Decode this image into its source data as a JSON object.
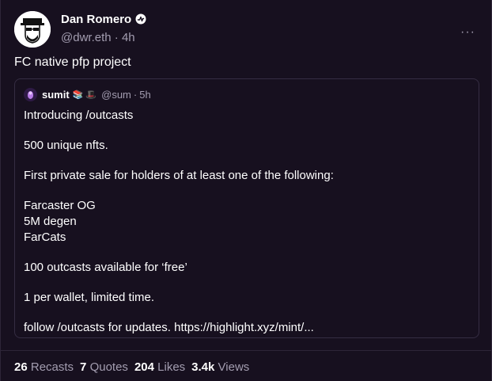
{
  "post": {
    "author_name": "Dan Romero",
    "author_handle": "@dwr.eth",
    "separator": "·",
    "time": "4h",
    "more_label": "···",
    "text": "FC native pfp project"
  },
  "quote": {
    "author_name": "sumit",
    "author_emojis": "📚 🎩",
    "author_handle": "@sum",
    "separator": "·",
    "time": "5h",
    "lines": [
      "Introducing /outcasts",
      "500 unique nfts.",
      "First private sale for holders of at least one of the following:",
      "Farcaster OG",
      "5M degen",
      "FarCats",
      "100 outcasts available for ‘free’",
      "1 per wallet, limited time.",
      "follow /outcasts for updates. https://highlight.xyz/mint/..."
    ]
  },
  "stats": {
    "recasts_count": "26",
    "recasts_label": "Recasts",
    "quotes_count": "7",
    "quotes_label": "Quotes",
    "likes_count": "204",
    "likes_label": "Likes",
    "views_count": "3.4k",
    "views_label": "Views"
  },
  "icons": {
    "verified": "verified-badge-icon",
    "more": "more-options-icon"
  },
  "colors": {
    "background": "#17101f",
    "muted_text": "#a39db0",
    "border": "#352d43"
  }
}
